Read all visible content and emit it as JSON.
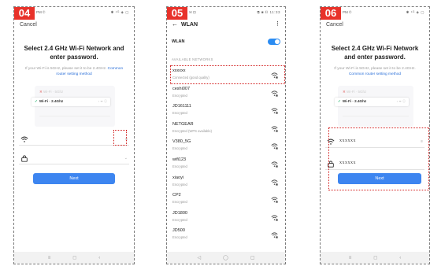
{
  "panel1": {
    "step": "04",
    "status_left": "PM ©",
    "status_right": "✱ ⁴ᴳ ◈ ▢",
    "cancel": "Cancel",
    "title": "Select 2.4 GHz Wi-Fi Network and enter password.",
    "hint_text": "If your Wi-Fi is 5GHz, please set it to be 2.4GHz.",
    "hint_link": "Common router setting method",
    "mini_top": "Wi-Fi · 5Ghz",
    "mini_selected": "Wi-Fi · 2.4Ghz",
    "mini_icons": "▫ ᯤ ⓘ",
    "next_label": "Next",
    "ssid_hint": "≡",
    "password_hint": "⌄"
  },
  "panel2": {
    "step": "05",
    "status_left": "✉ ⊡",
    "status_right": "⧉ ■ ▯ 11:33",
    "header": "WLAN",
    "wlan_label": "WLAN",
    "section_label": "AVAILABLE NETWORKS",
    "networks": [
      {
        "name": "xxxxxx",
        "status": "Connected (good quality)"
      },
      {
        "name": "ceshi007",
        "status": "Encrypted"
      },
      {
        "name": "JD161111",
        "status": "Encrypted"
      },
      {
        "name": "NETGEAR",
        "status": "Encrypted (WPS available)"
      },
      {
        "name": "V380_5G",
        "status": "Encrypted"
      },
      {
        "name": "wifi123",
        "status": "Encrypted"
      },
      {
        "name": "xiaoyi",
        "status": "Encrypted"
      },
      {
        "name": "CP2",
        "status": "Encrypted"
      },
      {
        "name": "JD1800",
        "status": "Encrypted"
      },
      {
        "name": "JD500",
        "status": "Encrypted"
      }
    ],
    "nav": [
      "◁",
      "◯",
      "▢"
    ]
  },
  "panel3": {
    "step": "06",
    "status_left": "PM ©",
    "status_right": "✱ ⁴ᴳ ◈ ▢",
    "cancel": "Cancel",
    "title": "Select 2.4 GHz Wi-Fi Network and enter password.",
    "hint_text": "If your Wi-Fi is 5GHz, please set it to be 2.4GHz.",
    "hint_link": "Common router setting method",
    "mini_top": "Wi-Fi · 5Ghz",
    "mini_selected": "Wi-Fi · 2.4Ghz",
    "mini_icons": "▫ ᯤ ⓘ",
    "ssid_value": "xxxxxx",
    "password_value": "xxxxxx",
    "ssid_hint": "≡",
    "next_label": "Next"
  },
  "nav": [
    "≡",
    "◻",
    "‹"
  ],
  "colors": {
    "accent": "#3d85f0",
    "step_badge": "#e8322a",
    "highlight": "#d21e1e",
    "toggle": "#2b8cf2"
  }
}
